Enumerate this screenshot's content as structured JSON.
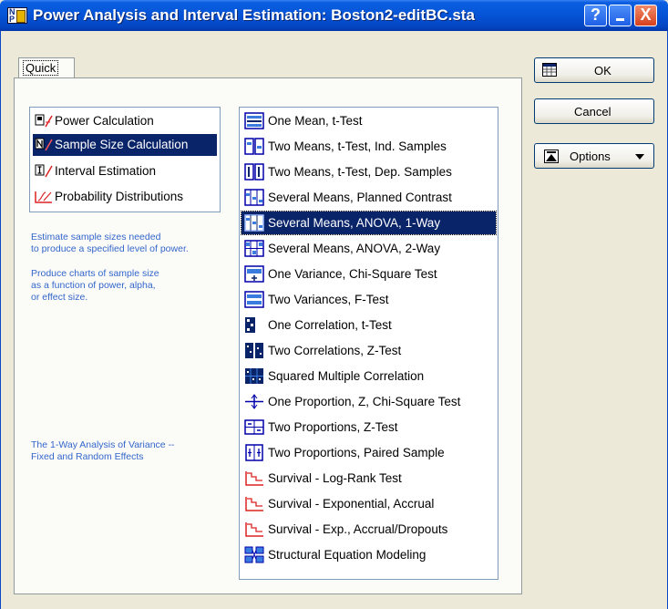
{
  "window": {
    "title": "Power Analysis and Interval Estimation: Boston2-editBC.sta",
    "help_label": "?",
    "min_label": "_",
    "close_label": "X"
  },
  "tabs": [
    {
      "label": "Quick",
      "selected": true
    }
  ],
  "left_list": [
    {
      "label": "Power Calculation",
      "icon": "power-calc-icon",
      "selected": false
    },
    {
      "label": "Sample Size Calculation",
      "icon": "sample-size-icon",
      "selected": true
    },
    {
      "label": "Interval Estimation",
      "icon": "interval-icon",
      "selected": false
    },
    {
      "label": "Probability Distributions",
      "icon": "prob-dist-icon",
      "selected": false
    }
  ],
  "descriptions": {
    "line1": "Estimate sample sizes needed",
    "line2": "to produce a specified level of power.",
    "line3": "Produce charts of sample size",
    "line4": "as a function of power, alpha,",
    "line5": "or effect size.",
    "bottom1": "The 1-Way Analysis of Variance --",
    "bottom2": "Fixed and Random Effects"
  },
  "right_list": [
    {
      "label": "One Mean, t-Test",
      "icon": "one-mean-icon",
      "selected": false
    },
    {
      "label": "Two Means, t-Test, Ind. Samples",
      "icon": "two-means-ind-icon",
      "selected": false
    },
    {
      "label": "Two Means, t-Test, Dep. Samples",
      "icon": "two-means-dep-icon",
      "selected": false
    },
    {
      "label": "Several Means, Planned Contrast",
      "icon": "planned-contrast-icon",
      "selected": false
    },
    {
      "label": "Several Means, ANOVA, 1-Way",
      "icon": "anova-1way-icon",
      "selected": true
    },
    {
      "label": "Several Means, ANOVA, 2-Way",
      "icon": "anova-2way-icon",
      "selected": false
    },
    {
      "label": "One Variance, Chi-Square Test",
      "icon": "one-variance-icon",
      "selected": false
    },
    {
      "label": "Two Variances, F-Test",
      "icon": "two-variances-icon",
      "selected": false
    },
    {
      "label": "One Correlation, t-Test",
      "icon": "one-correlation-icon",
      "selected": false
    },
    {
      "label": "Two Correlations, Z-Test",
      "icon": "two-correlations-icon",
      "selected": false
    },
    {
      "label": "Squared Multiple Correlation",
      "icon": "squared-multiple-icon",
      "selected": false
    },
    {
      "label": "One Proportion, Z, Chi-Square Test",
      "icon": "one-proportion-icon",
      "selected": false
    },
    {
      "label": "Two Proportions, Z-Test",
      "icon": "two-proportions-icon",
      "selected": false
    },
    {
      "label": "Two Proportions, Paired Sample",
      "icon": "paired-proportions-icon",
      "selected": false
    },
    {
      "label": "Survival - Log-Rank Test",
      "icon": "survival-icon",
      "selected": false
    },
    {
      "label": "Survival - Exponential, Accrual",
      "icon": "survival-icon",
      "selected": false
    },
    {
      "label": "Survival - Exp., Accrual/Dropouts",
      "icon": "survival-icon",
      "selected": false
    },
    {
      "label": "Structural Equation Modeling",
      "icon": "sem-icon",
      "selected": false
    }
  ],
  "buttons": {
    "ok": "OK",
    "cancel": "Cancel",
    "options": "Options"
  },
  "colors": {
    "titlebar": "#0553d6",
    "selection": "#0a246a",
    "description_text": "#3366cc",
    "dialog_bg": "#ece9d8"
  }
}
